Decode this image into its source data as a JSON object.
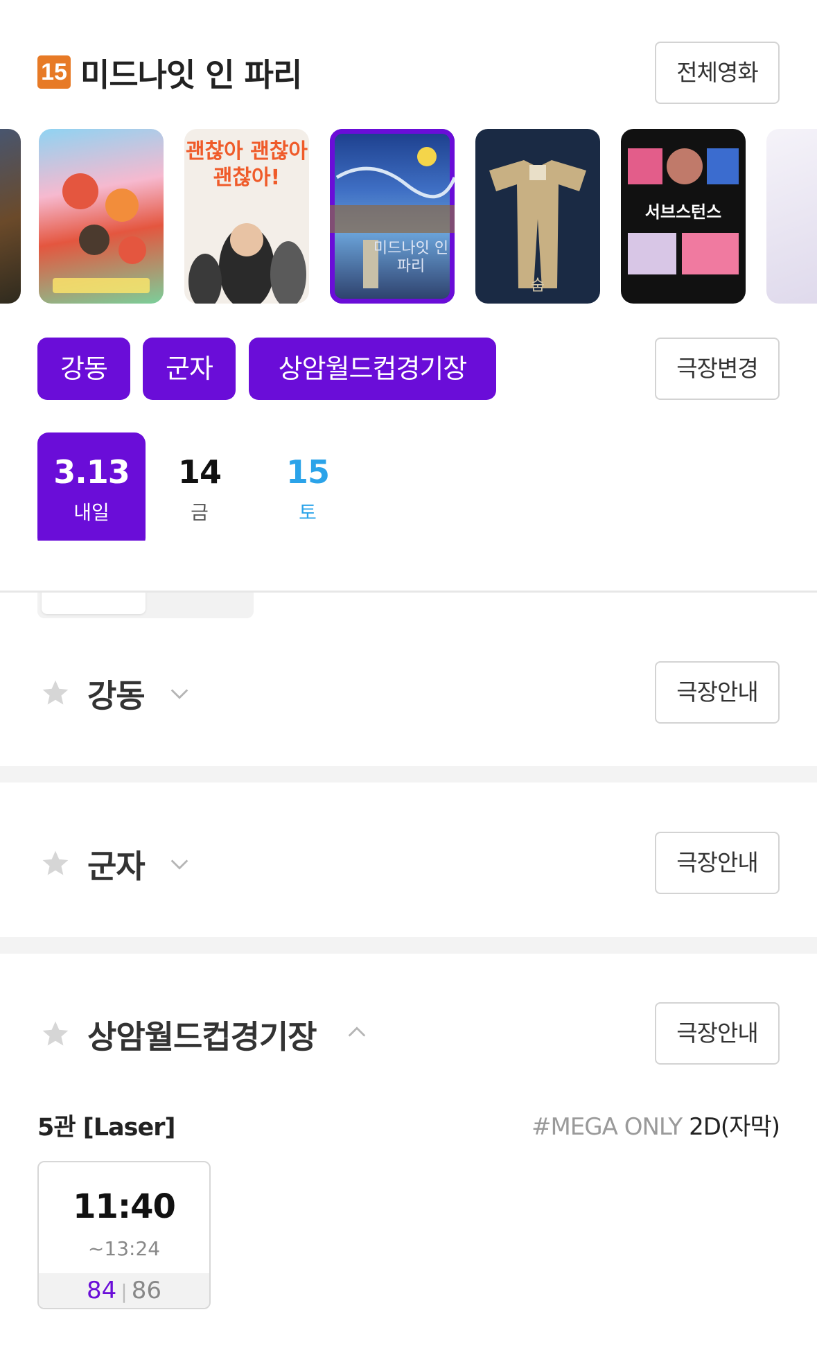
{
  "header": {
    "rating": "15",
    "title": "미드나잇 인 파리",
    "all_movies_label": "전체영화"
  },
  "posters": [
    {
      "text": "",
      "color": "#6b4a2a"
    },
    {
      "text": "",
      "color": "#f08cb0"
    },
    {
      "text": "괜찮아 괜찮아 괜찮아!",
      "color": "#f3eee8"
    },
    {
      "text": "미드나잇 인 파리",
      "color": "#2452a3",
      "selected": true
    },
    {
      "text": "숨",
      "color": "#1a2a44"
    },
    {
      "text": "서브스턴스",
      "color": "#1a1a1a"
    },
    {
      "text": "",
      "color": "#eceaf3"
    }
  ],
  "theater_chips": [
    "강동",
    "군자",
    "상암월드컵경기장"
  ],
  "change_theater_label": "극장변경",
  "dates": [
    {
      "num": "3.13",
      "label": "내일",
      "active": true
    },
    {
      "num": "14",
      "label": "금"
    },
    {
      "num": "15",
      "label": "토",
      "color": "#2ba3e9"
    }
  ],
  "theaters": [
    {
      "name": "강동",
      "info_label": "극장안내",
      "expanded": false
    },
    {
      "name": "군자",
      "info_label": "극장안내",
      "expanded": false
    },
    {
      "name": "상암월드컵경기장",
      "info_label": "극장안내",
      "expanded": true
    }
  ],
  "screening": {
    "screen": "5관 [Laser]",
    "tag": "#MEGA ONLY",
    "format": "2D(자막)",
    "showtime": {
      "start": "11:40",
      "end": "~13:24",
      "available": "84",
      "total": "86"
    }
  },
  "colors": {
    "accent": "#6a0dd8",
    "saturday": "#2ba3e9",
    "rating15": "#e77a26"
  }
}
